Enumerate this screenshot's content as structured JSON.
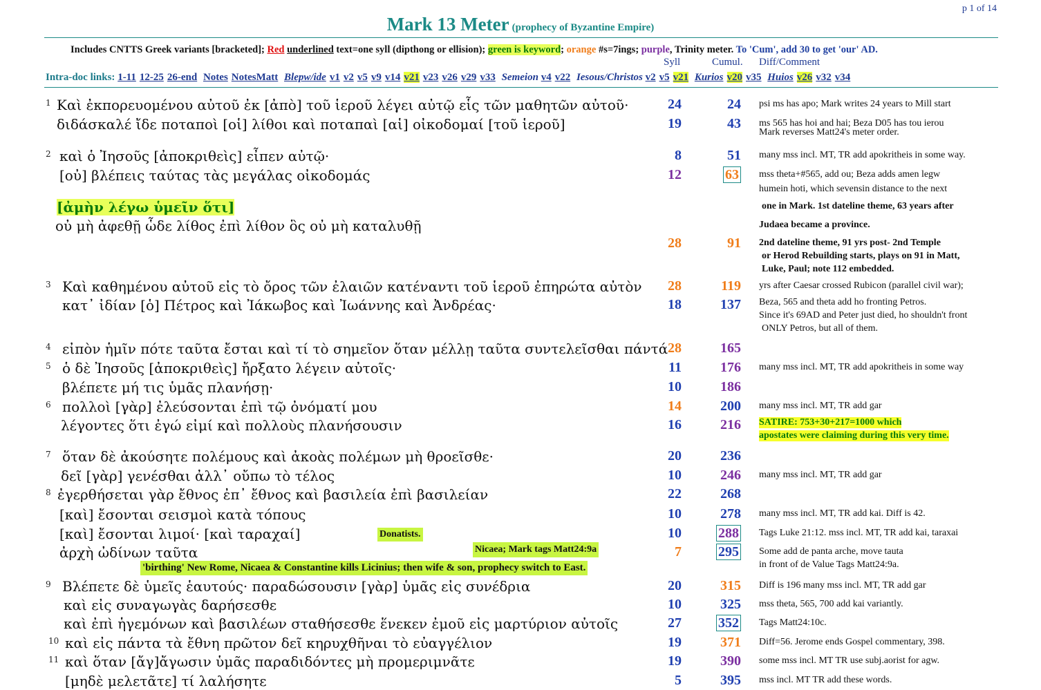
{
  "page_number": "p 1 of 14",
  "title": "Mark 13 Meter",
  "subtitle": "(prophecy of Byzantine Empire)",
  "legend": {
    "p1": "Includes CNTTS Greek variants  [bracketed]; ",
    "red": "Red",
    "underlined": "underlined",
    "p2": " text=one syll (dipthong or ellision); ",
    "green": "green is keyword",
    "p3": "; ",
    "orange": "orange",
    "p4": " #s=7ings; ",
    "purple": "purple",
    "p5": ", Trinity meter.  ",
    "p6": "To 'Cum', add 30 to get 'our' AD."
  },
  "col_headers": {
    "syll": "Syll",
    "cumul": "Cumul.",
    "comment": "Diff/Comment"
  },
  "links": {
    "label": "Intra-doc links:",
    "items": [
      "1-11",
      "12-25",
      "26-end",
      "Notes",
      "NotesMatt",
      "Blepw/ide",
      "v1",
      "v2",
      "v5",
      "v9",
      "v14",
      "v21",
      "v23",
      "v26",
      "v29",
      "v33",
      "Semeion",
      "v4",
      "v22",
      "Iesous/Christos",
      "v2",
      "v5",
      "v21",
      "Kurios",
      "v20",
      "v35",
      "Huios",
      "v26",
      "v32",
      "v34"
    ]
  },
  "rows": [
    {
      "v": "1",
      "syll": "24",
      "cum": "24",
      "text": "Καὶ ἐκπορευομένου αὐτοῦ ἐκ [ἀπὸ] τοῦ ἱεροῦ λέγει αὐτῷ εἷς τῶν μαθητῶν αὐτοῦ·",
      "comment": "psi ms has apo; Mark writes 24 years to Mill start"
    },
    {
      "v": "",
      "syll": "19",
      "cum": "43",
      "text": "διδάσκαλέ ἴδε ποταποὶ [οἱ] λίθοι καὶ ποταπαὶ [αἱ] οἰκοδομαί [τοῦ ἱεροῦ]",
      "comment": "ms 565 has hoi and hai; Beza D05 has tou ierou",
      "comment2": "Mark reverses Matt24's meter order."
    },
    {
      "v": "2",
      "syll": "8",
      "cum": "51",
      "text": "καὶ ὁ Ἰησοῦς [ἀποκριθεὶς] εἶπεν αὐτῷ·",
      "comment": "many mss incl. MT, TR add apokritheis in some way."
    },
    {
      "v": "",
      "syll": "12",
      "cum": "63",
      "text": "[οὐ] βλέπεις ταύτας τὰς μεγάλας οἰκοδομάς",
      "comment": "mss theta+#565, add ou; Beza adds amen legw",
      "comment2": "humein hoti, which sevensin distance to the next"
    },
    {
      "v": "",
      "syll": "",
      "cum": "",
      "text": "[ἀμὴν λέγω ὑμεῖν ὅτι]",
      "comment": "one in Mark. 1st dateline theme, 63 years after"
    },
    {
      "v": "",
      "syll": "",
      "cum": "",
      "text": "οὐ μὴ ἀφεθῇ ὧδε λίθος ἐπὶ λίθον ὃς οὐ μὴ καταλυθῇ",
      "comment": "Judaea became a province."
    },
    {
      "v": "",
      "syll": "28",
      "cum": "91",
      "text": "",
      "comment": "2nd dateline theme, 91 yrs post- 2nd Temple",
      "comment2": "or Herod Rebuilding starts,  plays on 91 in Matt,",
      "comment3": "Luke, Paul; note 112 embedded."
    },
    {
      "v": "3",
      "syll": "28",
      "cum": "119",
      "text": "Καὶ καθημένου αὐτοῦ εἰς τὸ ὄρος τῶν ἐλαιῶν κατέναντι τοῦ ἱεροῦ ἐπηρώτα αὐτὸν",
      "comment": "yrs after Caesar crossed Rubicon (parallel civil war);"
    },
    {
      "v": "",
      "syll": "18",
      "cum": "137",
      "text": "κατ᾽ ἰδίαν [ὁ] Πέτρος καὶ Ἰάκωβος καὶ Ἰωάννης καὶ Ἀνδρέας·",
      "comment": "Beza, 565 and theta add ho fronting Petros.",
      "comment2": "Since it's 69AD and Peter just died, ho shouldn't front",
      "comment3": "ONLY Petros, but all of them."
    },
    {
      "v": "4",
      "syll": "28",
      "cum": "165",
      "text": "εἰπὸν ἡμῖν πότε ταῦτα ἔσται καὶ τί τὸ σημεῖον ὅταν μέλλῃ ταῦτα συντελεῖσθαι πάντά",
      "comment": ""
    },
    {
      "v": "5",
      "syll": "11",
      "cum": "176",
      "text": "ὁ δὲ Ἰησοῦς [ἀποκριθεὶς] ἤρξατο λέγειν αὐτοῖς·",
      "comment": "many mss incl. MT, TR add apokritheis in some way"
    },
    {
      "v": "",
      "syll": "10",
      "cum": "186",
      "text": "βλέπετε μή τις ὑμᾶς πλανήσῃ·",
      "comment": ""
    },
    {
      "v": "6",
      "syll": "14",
      "cum": "200",
      "text": "πολλοὶ [γὰρ] ἐλεύσονται ἐπὶ τῷ ὀνόματί μου",
      "comment": "many mss incl. MT, TR add gar"
    },
    {
      "v": "",
      "syll": "16",
      "cum": "216",
      "text": "λέγοντες ὅτι ἐγώ εἰμί καὶ πολλοὺς πλανήσουσιν",
      "comment": "SATIRE: 753+30+217=1000 which",
      "comment2": "apostates were claiming during this very time."
    },
    {
      "v": "7",
      "syll": "20",
      "cum": "236",
      "text": "ὅταν δὲ ἀκούσητε πολέμους καὶ ἀκοὰς πολέμων μὴ θροεῖσθε·",
      "comment": ""
    },
    {
      "v": "",
      "syll": "10",
      "cum": "246",
      "text": "δεῖ [γὰρ] γενέσθαι ἀλλ᾽ οὔπω τὸ τέλος",
      "comment": "many mss incl. MT, TR add gar"
    },
    {
      "v": "8",
      "syll": "22",
      "cum": "268",
      "text": "ἐγερθήσεται γὰρ ἔθνος ἐπ᾽ ἔθνος καὶ βασιλεία ἐπὶ βασιλείαν",
      "comment": ""
    },
    {
      "v": "",
      "syll": "10",
      "cum": "278",
      "text": "[καὶ] ἔσονται σεισμοὶ κατὰ τόπους",
      "comment": "many mss incl. MT, TR add kai. Diff is 42."
    },
    {
      "v": "",
      "syll": "10",
      "cum": "288",
      "text": "[καὶ] ἔσονται λιμοί· [καὶ ταραχαί]",
      "comment": "Tags Luke 21:12. mss incl. MT, TR add kai, taraxai"
    },
    {
      "v": "",
      "syll": "7",
      "cum": "295",
      "text": "ἀρχὴ ὠδίνων ταῦτα",
      "comment": "Some add de panta arche, move tauta",
      "comment2": "in front of de Value Tags Matt24:9a."
    },
    {
      "v": "9",
      "syll": "20",
      "cum": "315",
      "text": "Βλέπετε δὲ ὑμεῖς ἑαυτούς· παραδώσουσιν [γὰρ] ὑμᾶς εἰς συνέδρια",
      "comment": "Diff is 196  many mss incl. MT, TR add gar"
    },
    {
      "v": "",
      "syll": "10",
      "cum": "325",
      "text": "καὶ εἰς συναγωγὰς δαρήσεσθε",
      "comment": "mss theta, 565, 700 add kai variantly."
    },
    {
      "v": "",
      "syll": "27",
      "cum": "352",
      "text": "καὶ ἐπὶ ἡγεμόνων καὶ βασιλέων σταθήσεσθε ἕνεκεν ἐμοῦ εἰς μαρτύριον αὐτοῖς",
      "comment": "Tags Matt24:10c."
    },
    {
      "v": "10",
      "syll": "19",
      "cum": "371",
      "text": "καὶ εἰς πάντα τὰ ἔθνη πρῶτον δεῖ κηρυχθῆναι τὸ εὐαγγέλιον",
      "comment": "Diff=56.  Jerome ends Gospel commentary, 398."
    },
    {
      "v": "11",
      "syll": "19",
      "cum": "390",
      "text": "καὶ ὅταν [ἄγ]ἄγωσιν ὑμᾶς παραδιδόντες μὴ προμεριμνᾶτε",
      "comment": "some mss incl. MT TR use subj.aorist for agw."
    },
    {
      "v": "",
      "syll": "5",
      "cum": "395",
      "text": "[μηδὲ μελετᾶτε] τί λαλήσητε",
      "comment": "mss incl. MT TR add these words."
    }
  ],
  "callouts": {
    "donatists": "Donatists.",
    "nicaea": "Nicaea; Mark tags Matt24:9a",
    "birthing": "'birthing' New Rome, Nicaea & Constantine kills Licinius; then wife & son, prophecy switch to East."
  },
  "colors": {
    "teal": "#1b8a86",
    "blue": "#1f3fb0",
    "orange": "#f07d1a",
    "purple": "#7b2fa0",
    "red": "#e01010",
    "green": "#0a7a0a",
    "yellow": "#f6ff2a",
    "lime": "#c8f542"
  }
}
